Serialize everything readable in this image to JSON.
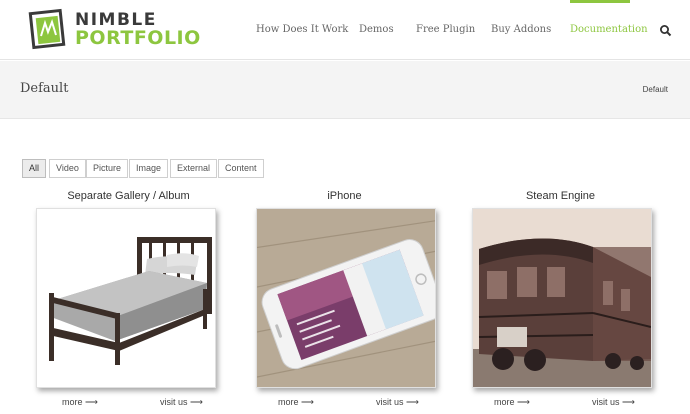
{
  "header": {
    "logo": {
      "line1": "NIMBLE",
      "line2": "PORTFOLIO"
    },
    "nav": [
      {
        "label": "How Does It Work"
      },
      {
        "label": "Demos"
      },
      {
        "label": "Free Plugin"
      },
      {
        "label": "Buy Addons"
      },
      {
        "label": "Documentation",
        "active": true
      }
    ],
    "search_icon": "search-icon"
  },
  "title_bar": {
    "title": "Default",
    "breadcrumb": "Default"
  },
  "filters": [
    {
      "label": "All",
      "active": true
    },
    {
      "label": "Video"
    },
    {
      "label": "Picture"
    },
    {
      "label": "Image"
    },
    {
      "label": "External"
    },
    {
      "label": "Content"
    }
  ],
  "items": [
    {
      "title": "Separate Gallery / Album",
      "more": "more ⟶",
      "visit": "visit us ⟶"
    },
    {
      "title": "iPhone",
      "more": "more ⟶",
      "visit": "visit us ⟶"
    },
    {
      "title": "Steam Engine",
      "more": "more ⟶",
      "visit": "visit us ⟶"
    }
  ],
  "colors": {
    "accent": "#8dc63f",
    "text": "#333333",
    "title_bar_bg": "#f4f4f4"
  }
}
